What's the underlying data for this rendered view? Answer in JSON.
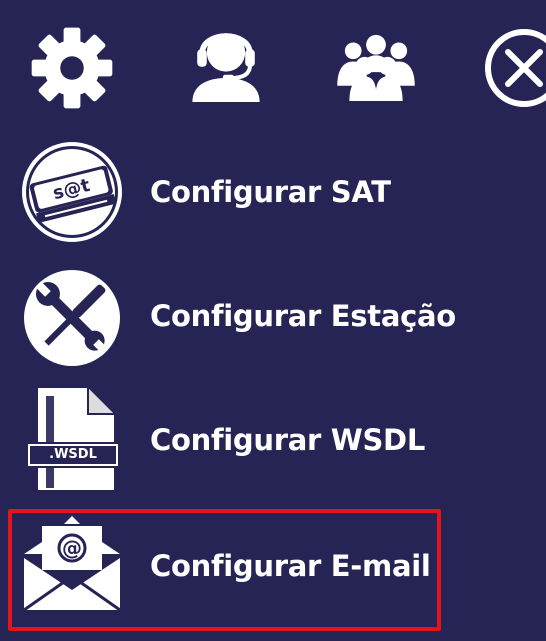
{
  "toolbar": {
    "icons": [
      "gear-icon",
      "support-agent-icon",
      "users-group-icon",
      "close-icon"
    ]
  },
  "menu": {
    "items": [
      {
        "label": "Configurar SAT",
        "icon": "sat-device-icon"
      },
      {
        "label": "Configurar Estação",
        "icon": "tools-icon"
      },
      {
        "label": "Configurar WSDL",
        "icon": "wsdl-file-icon",
        "icon_text": ".WSDL"
      },
      {
        "label": "Configurar E-mail",
        "icon": "email-envelope-icon",
        "selected": true
      }
    ]
  },
  "colors": {
    "background": "#262455",
    "foreground": "#ffffff",
    "highlight": "#e3141b"
  }
}
